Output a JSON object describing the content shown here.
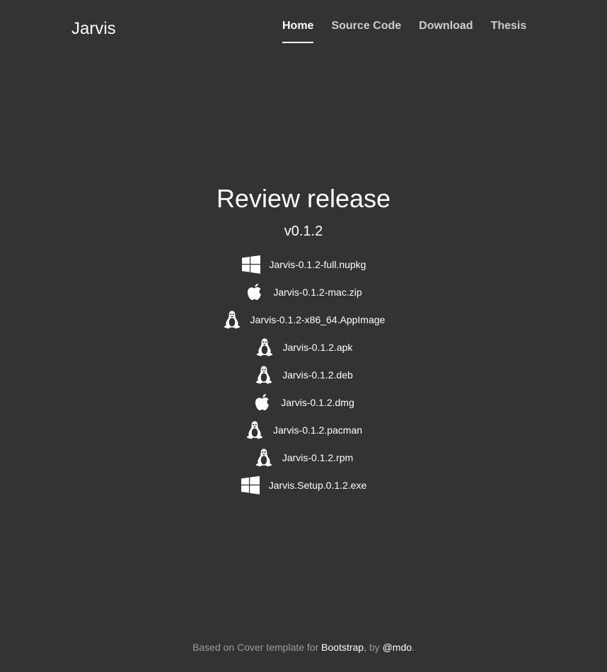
{
  "header": {
    "brand": "Jarvis",
    "nav": [
      {
        "label": "Home",
        "active": true
      },
      {
        "label": "Source Code",
        "active": false
      },
      {
        "label": "Download",
        "active": false
      },
      {
        "label": "Thesis",
        "active": false
      }
    ]
  },
  "main": {
    "title": "Review release",
    "version": "v0.1.2",
    "downloads": [
      {
        "icon": "windows-icon",
        "filename": "Jarvis-0.1.2-full.nupkg"
      },
      {
        "icon": "apple-icon",
        "filename": "Jarvis-0.1.2-mac.zip"
      },
      {
        "icon": "linux-icon",
        "filename": "Jarvis-0.1.2-x86_64.AppImage"
      },
      {
        "icon": "linux-icon",
        "filename": "Jarvis-0.1.2.apk"
      },
      {
        "icon": "linux-icon",
        "filename": "Jarvis-0.1.2.deb"
      },
      {
        "icon": "apple-icon",
        "filename": "Jarvis-0.1.2.dmg"
      },
      {
        "icon": "linux-icon",
        "filename": "Jarvis-0.1.2.pacman"
      },
      {
        "icon": "linux-icon",
        "filename": "Jarvis-0.1.2.rpm"
      },
      {
        "icon": "windows-icon",
        "filename": "Jarvis.Setup.0.1.2.exe"
      }
    ]
  },
  "footer": {
    "prefix": "Based on Cover template for ",
    "link1": "Bootstrap",
    "middle": ", by ",
    "link2": "@mdo",
    "suffix": "."
  },
  "colors": {
    "background": "#333333",
    "text": "#ffffff"
  }
}
